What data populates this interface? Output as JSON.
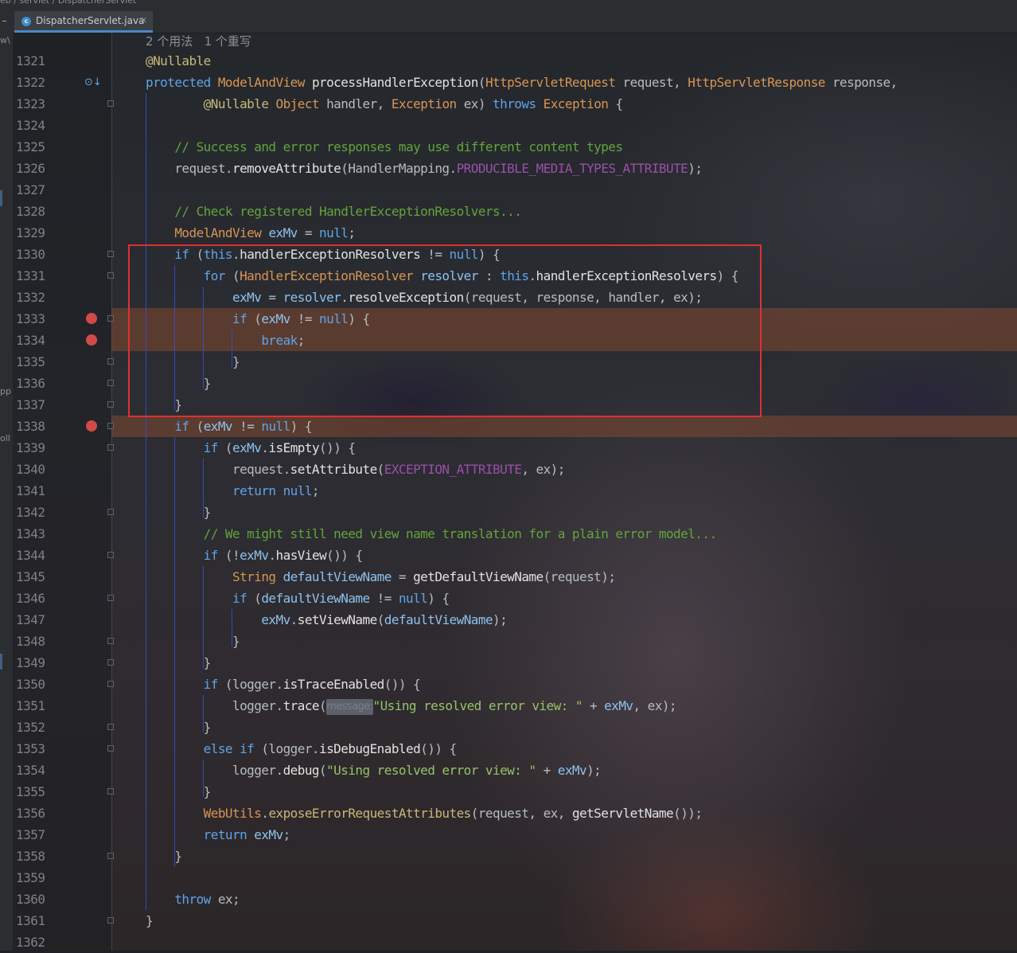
{
  "breadcrumb": "eb  /  servlet  /  DispatcherServlet",
  "tab": {
    "icon": "class-c-icon",
    "label": "DispatcherServlet.java",
    "close": "✕"
  },
  "left_strip": [
    "w\\",
    "pp",
    "oll"
  ],
  "usage_hint": "2 个用法   1 个重写",
  "parameter_hint": "message:",
  "lines": [
    {
      "n": "1321",
      "html": "<span class=\"a\">@Nullable</span>"
    },
    {
      "n": "1322",
      "html": "<span class=\"k\">protected</span> <span class=\"t\">ModelAndView</span> <span class=\"m\">processHandlerException</span>(<span class=\"t\">HttpServletRequest</span> request, <span class=\"t\">HttpServletResponse</span> response,"
    },
    {
      "n": "1323",
      "html": "        <span class=\"a\">@Nullable</span> <span class=\"t\">Object</span> handler, <span class=\"t\">Exception</span> ex) <span class=\"k\">throws</span> <span class=\"t\">Exception</span> {"
    },
    {
      "n": "1324",
      "html": ""
    },
    {
      "n": "1325",
      "html": "    <span class=\"c\">// Success and error responses may use different content types</span>"
    },
    {
      "n": "1326",
      "html": "    request.<span class=\"m\">removeAttribute</span>(HandlerMapping.<span class=\"f\">PRODUCIBLE_MEDIA_TYPES_ATTRIBUTE</span>);"
    },
    {
      "n": "1327",
      "html": ""
    },
    {
      "n": "1328",
      "html": "    <span class=\"c\">// Check registered HandlerExceptionResolvers...</span>"
    },
    {
      "n": "1329",
      "html": "    <span class=\"t\">ModelAndView</span> <span class=\"v\">exMv</span> = <span class=\"k\">null</span>;"
    },
    {
      "n": "1330",
      "html": "    <span class=\"k\">if</span> (<span class=\"k\">this</span>.<span class=\"m\">handlerExceptionResolvers</span> != <span class=\"k\">null</span>) {"
    },
    {
      "n": "1331",
      "html": "        <span class=\"k\">for</span> (<span class=\"t\">HandlerExceptionResolver</span> <span class=\"v\">resolver</span> : <span class=\"k\">this</span>.<span class=\"m\">handlerExceptionResolvers</span>) {"
    },
    {
      "n": "1332",
      "html": "            <span class=\"v\">exMv</span> = <span class=\"v\">resolver</span>.<span class=\"m\">resolveException</span>(request, response, handler, ex);"
    },
    {
      "n": "1333",
      "html": "            <span class=\"k\">if</span> (<span class=\"v\">exMv</span> != <span class=\"k\">null</span>) {"
    },
    {
      "n": "1334",
      "html": "                <span class=\"k\">break</span>;"
    },
    {
      "n": "1335",
      "html": "            }"
    },
    {
      "n": "1336",
      "html": "        }"
    },
    {
      "n": "1337",
      "html": "    }"
    },
    {
      "n": "1338",
      "html": "    <span class=\"k\">if</span> (<span class=\"v\">exMv</span> != <span class=\"k\">null</span>) {"
    },
    {
      "n": "1339",
      "html": "        <span class=\"k\">if</span> (<span class=\"v\">exMv</span>.<span class=\"m\">isEmpty</span>()) {"
    },
    {
      "n": "1340",
      "html": "            request.<span class=\"m\">setAttribute</span>(<span class=\"f\">EXCEPTION_ATTRIBUTE</span>, ex);"
    },
    {
      "n": "1341",
      "html": "            <span class=\"k\">return null</span>;"
    },
    {
      "n": "1342",
      "html": "        }"
    },
    {
      "n": "1343",
      "html": "        <span class=\"c\">// We might still need view name translation for a plain error model...</span>"
    },
    {
      "n": "1344",
      "html": "        <span class=\"k\">if</span> (!<span class=\"v\">exMv</span>.<span class=\"m\">hasView</span>()) {"
    },
    {
      "n": "1345",
      "html": "            <span class=\"t\">String</span> <span class=\"v\">defaultViewName</span> = <span class=\"m\">getDefaultViewName</span>(request);"
    },
    {
      "n": "1346",
      "html": "            <span class=\"k\">if</span> (<span class=\"v\">defaultViewName</span> != <span class=\"k\">null</span>) {"
    },
    {
      "n": "1347",
      "html": "                <span class=\"v\">exMv</span>.<span class=\"m\">setViewName</span>(<span class=\"v\">defaultViewName</span>);"
    },
    {
      "n": "1348",
      "html": "            }"
    },
    {
      "n": "1349",
      "html": "        }"
    },
    {
      "n": "1350",
      "html": "        <span class=\"k\">if</span> (logger.<span class=\"m\">isTraceEnabled</span>()) {"
    },
    {
      "n": "1351",
      "html": "            logger.<span class=\"m\">trace</span>(<span class=\"hint\" data-name=\"parameter-hint\" data-interactable=\"false\" data-bind=\"parameter_hint\"></span><span class=\"s\">\"Using resolved error view: \"</span> + <span class=\"v\">exMv</span>, ex);"
    },
    {
      "n": "1352",
      "html": "        }"
    },
    {
      "n": "1353",
      "html": "        <span class=\"k\">else if</span> (logger.<span class=\"m\">isDebugEnabled</span>()) {"
    },
    {
      "n": "1354",
      "html": "            logger.<span class=\"m\">debug</span>(<span class=\"s\">\"Using resolved error view: \"</span> + <span class=\"v\">exMv</span>);"
    },
    {
      "n": "1355",
      "html": "        }"
    },
    {
      "n": "1356",
      "html": "        <span class=\"t\">WebUtils</span>.<span class=\"a\">exposeErrorRequestAttributes</span>(request, ex, <span class=\"m\">getServletName</span>());"
    },
    {
      "n": "1357",
      "html": "        <span class=\"k\">return</span> <span class=\"v\">exMv</span>;"
    },
    {
      "n": "1358",
      "html": "    }"
    },
    {
      "n": "1359",
      "html": ""
    },
    {
      "n": "1360",
      "html": "    <span class=\"k\">throw</span> ex;"
    },
    {
      "n": "1361",
      "html": "}"
    },
    {
      "n": "1362",
      "html": ""
    }
  ],
  "breakpoint_lines": [
    "1333",
    "1334",
    "1338"
  ],
  "highlighted_lines": [
    "1333",
    "1334",
    "1338"
  ],
  "fold_lines": [
    "1323",
    "1330",
    "1331",
    "1333",
    "1335",
    "1336",
    "1337",
    "1338",
    "1339",
    "1342",
    "1344",
    "1346",
    "1348",
    "1349",
    "1350",
    "1352",
    "1353",
    "1355",
    "1358",
    "1361"
  ],
  "override_marker_line": "1322",
  "colors": {
    "keyword": "#5fa4e8",
    "type": "#d99552",
    "comment": "#62a53a",
    "string": "#95c466",
    "constant": "#9a4fa8",
    "breakpoint": "#d24a48",
    "highlight": "#824830",
    "annotation_box": "#e03030"
  }
}
